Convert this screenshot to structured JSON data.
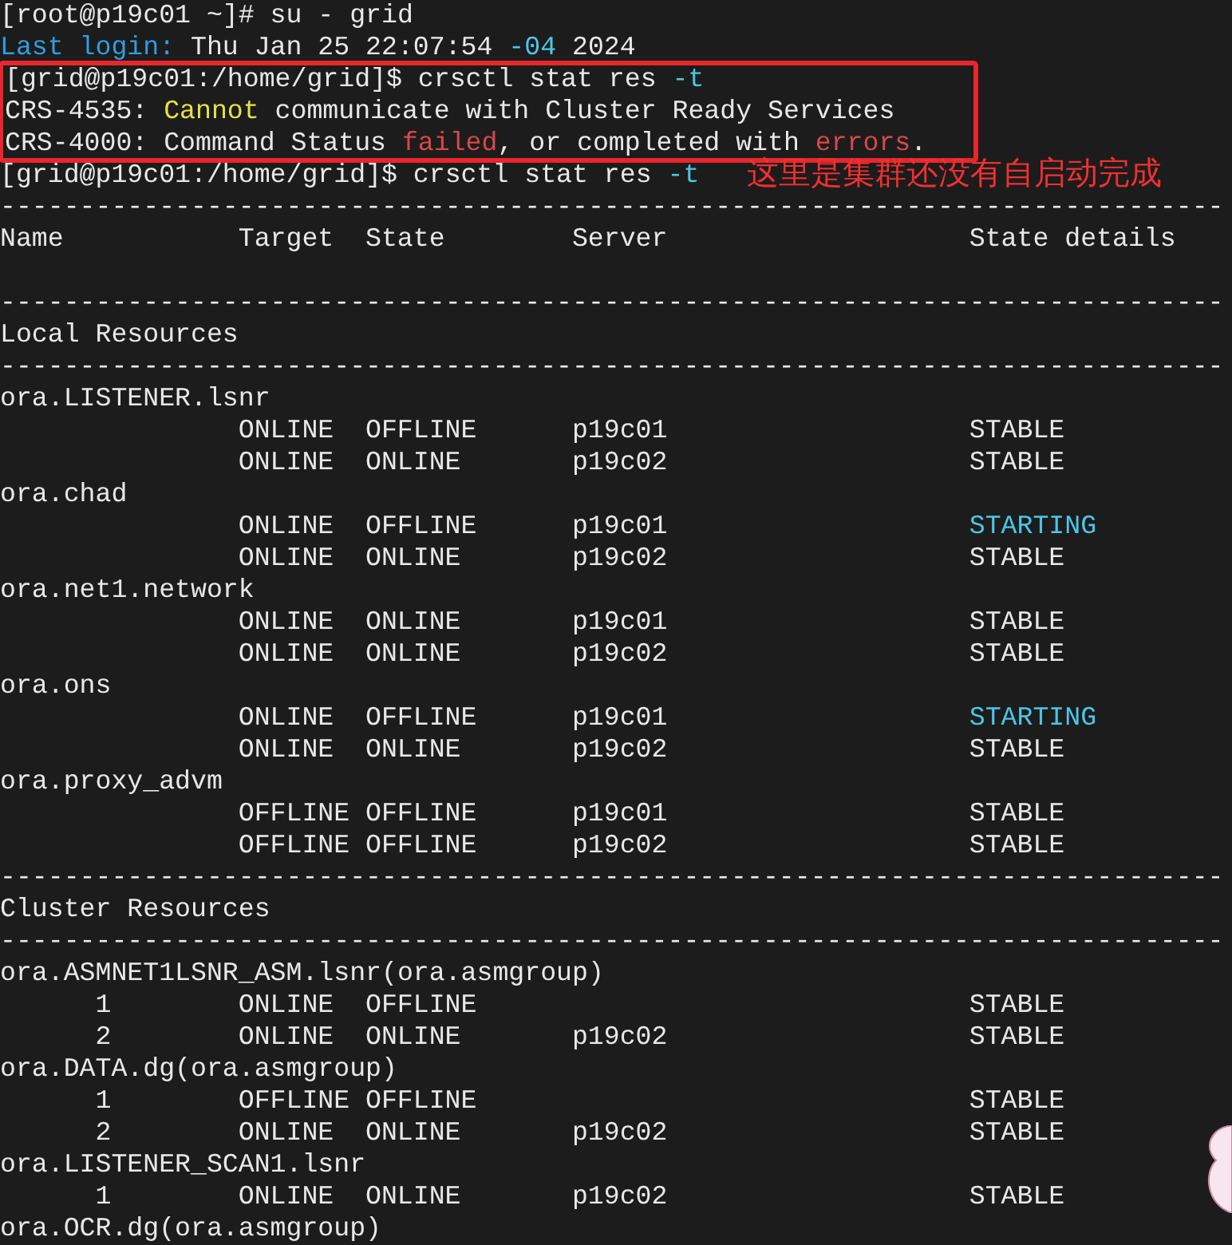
{
  "terminal": {
    "lines_before": [
      {
        "kind": "text",
        "segments": [
          {
            "text": "[root@p19c01 ~]# su - grid",
            "color": "#e8e8e8"
          }
        ]
      },
      {
        "kind": "text",
        "segments": [
          {
            "text": "Last login:",
            "color": "#2f9ee0"
          },
          {
            "text": " Thu Jan 25 22:07:54 ",
            "color": "#e8e8e8"
          },
          {
            "text": "-04",
            "color": "#4cc6e6"
          },
          {
            "text": " 2024",
            "color": "#e8e8e8"
          }
        ]
      }
    ],
    "highlighted": [
      {
        "kind": "text",
        "segments": [
          {
            "text": "[grid@p19c01:/home/grid]$ crsctl stat res ",
            "color": "#e8e8e8"
          },
          {
            "text": "-t",
            "color": "#4cc6e6"
          }
        ]
      },
      {
        "kind": "text",
        "segments": [
          {
            "text": "CRS-4535: ",
            "color": "#e8e8e8"
          },
          {
            "text": "Cannot",
            "color": "#e6e04a"
          },
          {
            "text": " communicate with Cluster Ready Services",
            "color": "#e8e8e8"
          }
        ]
      },
      {
        "kind": "text",
        "segments": [
          {
            "text": "CRS-4000: Command Status ",
            "color": "#e8e8e8"
          },
          {
            "text": "failed",
            "color": "#d84848"
          },
          {
            "text": ", or completed with ",
            "color": "#e8e8e8"
          },
          {
            "text": "errors",
            "color": "#d84848"
          },
          {
            "text": ".",
            "color": "#e8e8e8"
          }
        ]
      }
    ],
    "lines_after": [
      {
        "kind": "text",
        "segments": [
          {
            "text": "[grid@p19c01:/home/grid]$ crsctl stat res ",
            "color": "#e8e8e8"
          },
          {
            "text": "-t",
            "color": "#4cc6e6"
          }
        ],
        "note": "这里是集群还没有自启动完成"
      },
      {
        "kind": "rule",
        "text": "-----------------------------------------------------------------------------"
      },
      {
        "kind": "header",
        "columns": [
          "Name",
          "Target",
          "State",
          "Server",
          "State details"
        ]
      },
      {
        "kind": "blank"
      },
      {
        "kind": "rule",
        "text": "-----------------------------------------------------------------------------"
      },
      {
        "kind": "section",
        "text": "Local Resources"
      },
      {
        "kind": "rule",
        "text": "-----------------------------------------------------------------------------"
      },
      {
        "kind": "resource",
        "text": "ora.LISTENER.lsnr"
      },
      {
        "kind": "state",
        "target": "ONLINE",
        "state": "OFFLINE",
        "server": "p19c01",
        "details": "STABLE",
        "color": "#e8e8e8"
      },
      {
        "kind": "state",
        "target": "ONLINE",
        "state": "ONLINE",
        "server": "p19c02",
        "details": "STABLE",
        "color": "#e8e8e8"
      },
      {
        "kind": "resource",
        "text": "ora.chad"
      },
      {
        "kind": "state",
        "target": "ONLINE",
        "state": "OFFLINE",
        "server": "p19c01",
        "details": "STARTING",
        "color": "#4cc6e6"
      },
      {
        "kind": "state",
        "target": "ONLINE",
        "state": "ONLINE",
        "server": "p19c02",
        "details": "STABLE",
        "color": "#e8e8e8"
      },
      {
        "kind": "resource",
        "text": "ora.net1.network"
      },
      {
        "kind": "state",
        "target": "ONLINE",
        "state": "ONLINE",
        "server": "p19c01",
        "details": "STABLE",
        "color": "#e8e8e8"
      },
      {
        "kind": "state",
        "target": "ONLINE",
        "state": "ONLINE",
        "server": "p19c02",
        "details": "STABLE",
        "color": "#e8e8e8"
      },
      {
        "kind": "resource",
        "text": "ora.ons"
      },
      {
        "kind": "state",
        "target": "ONLINE",
        "state": "OFFLINE",
        "server": "p19c01",
        "details": "STARTING",
        "color": "#4cc6e6"
      },
      {
        "kind": "state",
        "target": "ONLINE",
        "state": "ONLINE",
        "server": "p19c02",
        "details": "STABLE",
        "color": "#e8e8e8"
      },
      {
        "kind": "resource",
        "text": "ora.proxy_advm"
      },
      {
        "kind": "state",
        "target": "OFFLINE",
        "state": "OFFLINE",
        "server": "p19c01",
        "details": "STABLE",
        "color": "#e8e8e8"
      },
      {
        "kind": "state",
        "target": "OFFLINE",
        "state": "OFFLINE",
        "server": "p19c02",
        "details": "STABLE",
        "color": "#e8e8e8"
      },
      {
        "kind": "rule",
        "text": "-----------------------------------------------------------------------------"
      },
      {
        "kind": "section",
        "text": "Cluster Resources"
      },
      {
        "kind": "rule",
        "text": "-----------------------------------------------------------------------------"
      },
      {
        "kind": "resource",
        "text": "ora.ASMNET1LSNR_ASM.lsnr(ora.asmgroup)"
      },
      {
        "kind": "state",
        "instance": "1",
        "target": "ONLINE",
        "state": "OFFLINE",
        "details": "STABLE",
        "color": "#e8e8e8"
      },
      {
        "kind": "state",
        "instance": "2",
        "target": "ONLINE",
        "state": "ONLINE",
        "server": "p19c02",
        "details": "STABLE",
        "color": "#e8e8e8"
      },
      {
        "kind": "resource",
        "text": "ora.DATA.dg(ora.asmgroup)"
      },
      {
        "kind": "state",
        "instance": "1",
        "target": "OFFLINE",
        "state": "OFFLINE",
        "details": "STABLE",
        "color": "#e8e8e8"
      },
      {
        "kind": "state",
        "instance": "2",
        "target": "ONLINE",
        "state": "ONLINE",
        "server": "p19c02",
        "details": "STABLE",
        "color": "#e8e8e8"
      },
      {
        "kind": "resource",
        "text": "ora.LISTENER_SCAN1.lsnr"
      },
      {
        "kind": "state",
        "instance": "1",
        "target": "ONLINE",
        "state": "ONLINE",
        "server": "p19c02",
        "details": "STABLE",
        "color": "#e8e8e8"
      },
      {
        "kind": "resource",
        "text": "ora.OCR.dg(ora.asmgroup)"
      }
    ]
  }
}
